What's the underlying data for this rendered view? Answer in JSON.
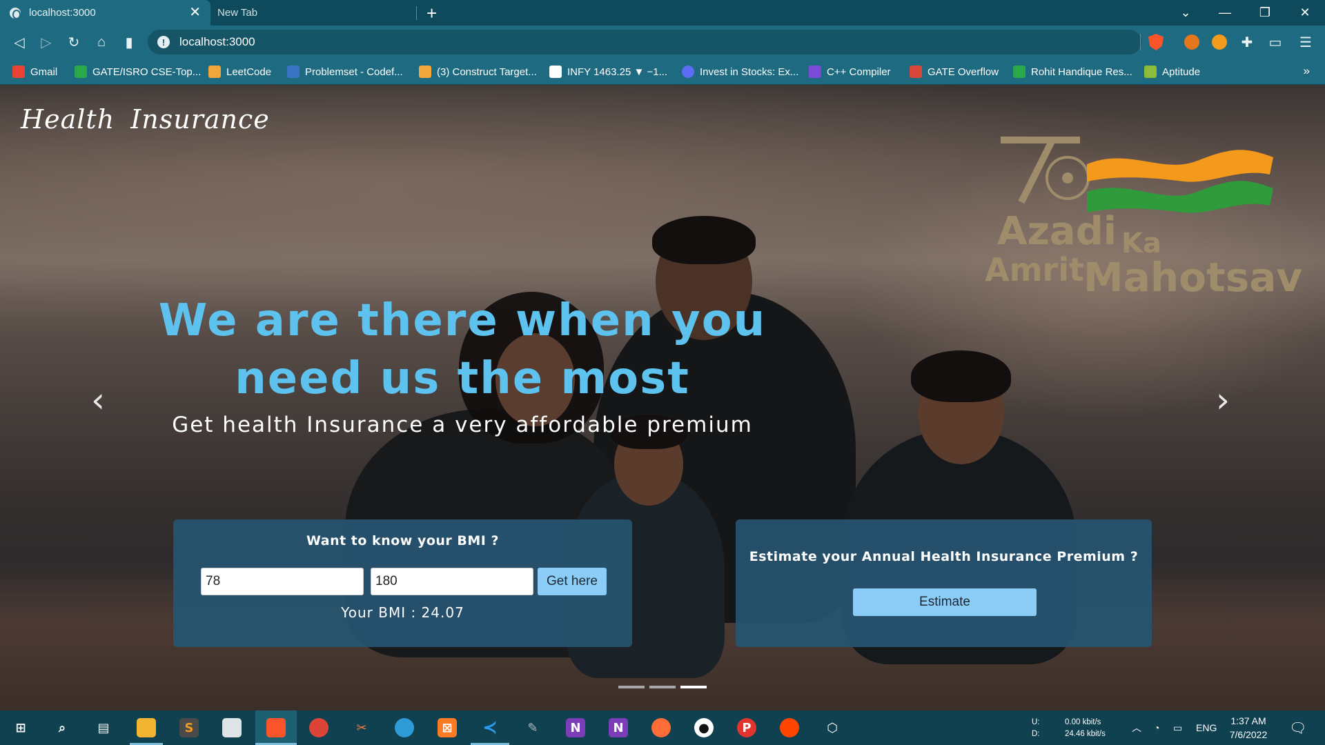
{
  "browser": {
    "tabs": [
      {
        "title": "localhost:3000",
        "active": true
      },
      {
        "title": "New Tab",
        "active": false
      }
    ],
    "url": "localhost:3000",
    "bookmarks": [
      {
        "label": "Gmail",
        "icon": "gmail-icon",
        "color": "#ea4335"
      },
      {
        "label": "GATE/ISRO CSE-Top...",
        "icon": "leaf-icon",
        "color": "#2aa84a"
      },
      {
        "label": "LeetCode",
        "icon": "leetcode-icon",
        "color": "#f0a63a"
      },
      {
        "label": "Problemset - Codef...",
        "icon": "codeforces-icon",
        "color": "#3b73c5"
      },
      {
        "label": "(3) Construct Target...",
        "icon": "leetcode-icon",
        "color": "#f0a63a"
      },
      {
        "label": "INFY 1463.25 ▼ −1...",
        "icon": "tradingview-icon",
        "color": "#ffffff"
      },
      {
        "label": "Invest in Stocks: Ex...",
        "icon": "groww-icon",
        "color": "#5d6df3"
      },
      {
        "label": "C++ Compiler",
        "icon": "bolt-icon",
        "color": "#7b4ad9"
      },
      {
        "label": "GATE Overflow",
        "icon": "cyclist-icon",
        "color": "#d9463a"
      },
      {
        "label": "Rohit Handique Res...",
        "icon": "resume-icon",
        "color": "#2aa84a"
      },
      {
        "label": "Aptitude",
        "icon": "leaf-icon",
        "color": "#8bbd3a"
      }
    ],
    "bookmarks_more": "»"
  },
  "page": {
    "brand": "Health  Insurance",
    "event_logo": {
      "line1": "Azadi",
      "line1b": "Ka",
      "line2": "Amrit",
      "line2b": "Mahotsav",
      "colors": {
        "saffron": "#f39a1c",
        "green": "#2f9b3a",
        "gold": "#9f8c6b"
      }
    },
    "headline": "We are there when you need us the most",
    "subheadline": "Get health Insurance a very affordable premium",
    "carousel": {
      "prev": "‹",
      "next": "›",
      "slides": 3,
      "active_slide": 3
    },
    "bmi_card": {
      "title": "Want to know your BMI ?",
      "weight_value": "78",
      "height_value": "180",
      "button": "Get here",
      "result_label": "Your BMI : 24.07"
    },
    "estimate_card": {
      "title": "Estimate your Annual Health Insurance Premium ?",
      "button": "Estimate"
    },
    "colors": {
      "headline": "#5ec2ef",
      "card": "#275470",
      "button": "#8ccdf7"
    }
  },
  "taskbar": {
    "network": {
      "up_label": "U:",
      "up_value": "0.00 kbit/s",
      "down_label": "D:",
      "down_value": "24.46 kbit/s"
    },
    "language": "ENG",
    "time": "1:37 AM",
    "date": "7/6/2022"
  }
}
